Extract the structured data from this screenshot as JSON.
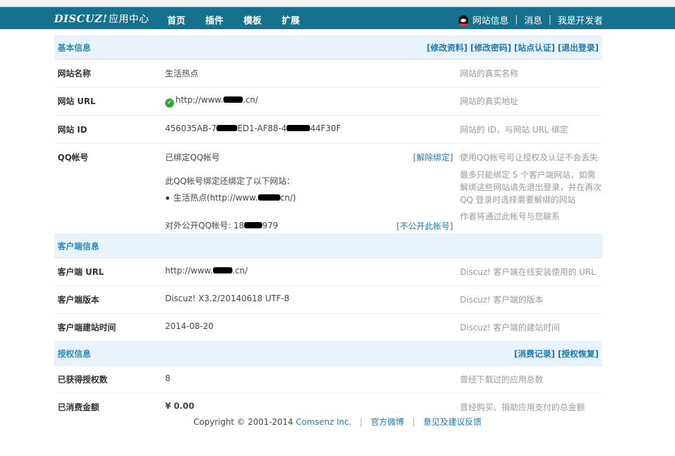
{
  "header": {
    "logo": "DISCUZ!",
    "logo_sub": "应用中心",
    "nav": [
      "首页",
      "插件",
      "模板",
      "扩展"
    ],
    "user": [
      "网站信息",
      "消息",
      "我是开发者"
    ]
  },
  "basic": {
    "title": "基本信息",
    "links": [
      "[修改资料]",
      "[修改密码]",
      "[站点认证]",
      "[退出登录]"
    ],
    "rows": {
      "name": {
        "k": "网站名称",
        "v": "生活热点",
        "d": "网站的真实名称"
      },
      "url": {
        "k": "网站 URL",
        "v1": "http://www.",
        "v2": ".cn/",
        "d": "网站的真实地址"
      },
      "id": {
        "k": "网站 ID",
        "v1": "456035AB-7",
        "v2": "ED1-AF88-4",
        "v3": "44F30F",
        "d": "网站的 ID，与网站 URL 绑定"
      },
      "qq": {
        "k": "QQ帐号",
        "v": "已绑定QQ帐号",
        "unbind": "[解除绑定]",
        "d": "使用QQ帐号可让授权及认证不会丢失",
        "bound_intro": "此QQ帐号绑定还绑定了以下网站：",
        "bound_site_a": "生活热点(http://www.",
        "bound_site_b": "cn/)",
        "bound_desc": "最多只能绑定 5 个客户端网站，如需解绑这些网站请先退出登录，并在再次 QQ 登录时选择需要解绑的网站",
        "public_label": "对外公开QQ帐号: 18",
        "public_tail": "979",
        "hide_link": "[不公开此帐号]",
        "public_desc": "作者将通过此帐号与您联系"
      }
    }
  },
  "client": {
    "title": "客户端信息",
    "rows": {
      "url": {
        "k": "客户端 URL",
        "v1": "http://www.",
        "v2": ".cn/",
        "d": "Discuz! 客户端在线安装使用的 URL"
      },
      "ver": {
        "k": "客户端版本",
        "v": "Discuz! X3.2/20140618 UTF-8",
        "d": "Discuz! 客户端的版本"
      },
      "date": {
        "k": "客户端建站时间",
        "v": "2014-08-20",
        "d": "Discuz! 客户端的建站时间"
      }
    }
  },
  "license": {
    "title": "授权信息",
    "links": [
      "[消费记录]",
      "[授权恢复]"
    ],
    "rows": {
      "count": {
        "k": "已获得授权数",
        "v": "8",
        "d": "曾经下载过的应用总数"
      },
      "spent": {
        "k": "已消费金额",
        "v": "¥ 0.00",
        "d": "曾经购买、捐助应用支付的总金额"
      }
    }
  },
  "footer": {
    "copyright": "Copyright © 2001-2014",
    "company": "Comsenz Inc.",
    "weibo": "官方微博",
    "feedback": "意见及建议反馈"
  }
}
